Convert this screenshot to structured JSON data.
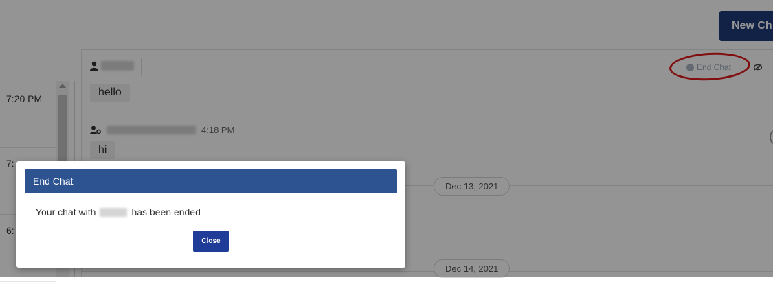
{
  "toolbar": {
    "new_chat_label": "New Ch"
  },
  "sessions": [
    {
      "time": "7:20 PM"
    },
    {
      "time": "7:"
    },
    {
      "time": "6:"
    }
  ],
  "chat": {
    "end_chat_label": "End Chat",
    "messages": [
      {
        "text": "hello"
      },
      {
        "time": "4:18 PM",
        "text": "hi"
      }
    ],
    "date_separators": [
      "Dec 13, 2021",
      "Dec 14, 2021"
    ]
  },
  "modal": {
    "title": "End Chat",
    "body_prefix": "Your chat with",
    "body_suffix": "has been ended",
    "close_label": "Close"
  },
  "colors": {
    "primary": "#1f3c7a",
    "modal_header": "#2d5490",
    "highlight_annotation": "#e01b1b"
  },
  "icons": [
    "agent-icon",
    "end-chat-icon",
    "eye-icon",
    "user-gear-icon",
    "scroll-up-icon"
  ]
}
